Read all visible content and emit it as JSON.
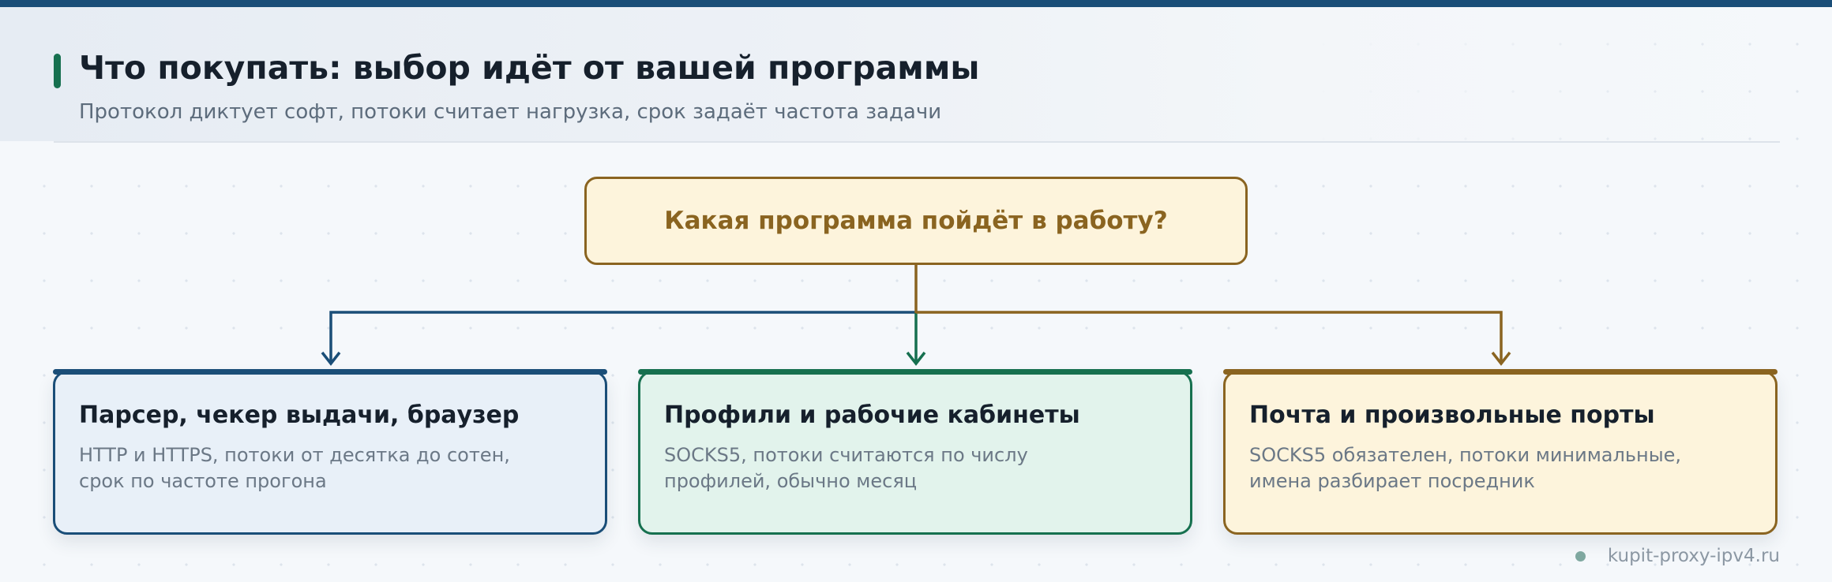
{
  "header": {
    "title": "Что покупать: выбор идёт от вашей программы",
    "subtitle": "Протокол диктует софт, потоки считает нагрузка, срок задаёт частота задачи"
  },
  "question": {
    "text": "Какая программа пойдёт в работу?"
  },
  "cards": [
    {
      "title": "Парсер, чекер выдачи, браузер",
      "text": "HTTP и HTTPS, потоки от десятка до сотен, срок по частоте прогона",
      "color": "#1a4e78"
    },
    {
      "title": "Профили и рабочие кабинеты",
      "text": "SOCKS5, потоки считаются по числу профилей, обычно месяц",
      "color": "#16704f"
    },
    {
      "title": "Почта и произвольные порты",
      "text": "SOCKS5 обязателен, потоки минимальные, имена разбирает посредник",
      "color": "#8a6420"
    }
  ],
  "footer": {
    "site": "kupit-proxy-ipv4.ru"
  },
  "colors": {
    "blue": "#1a4e78",
    "green": "#16704f",
    "gold": "#8a6420"
  }
}
